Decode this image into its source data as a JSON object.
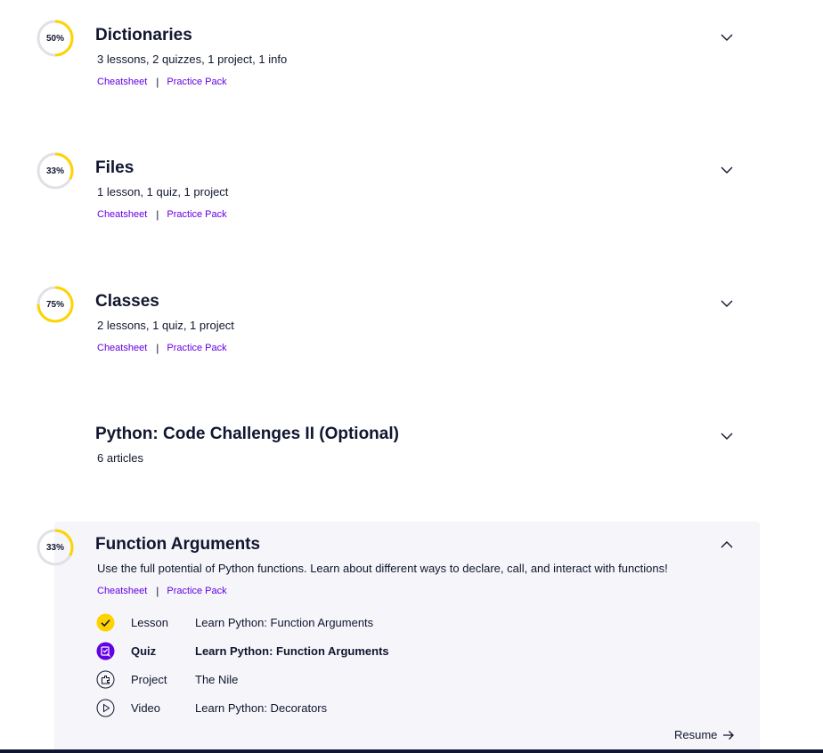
{
  "colors": {
    "ring_progress": "#ffd300",
    "ring_track": "#e0e0e6",
    "link": "#6400e4",
    "text": "#10162f",
    "panel_bg": "#f5f5fa",
    "quiz_icon_bg": "#6400e4"
  },
  "modules": [
    {
      "title": "Dictionaries",
      "progress_label": "50%",
      "progress": 0.5,
      "meta": "3 lessons, 2 quizzes, 1 project, 1 info",
      "links": {
        "cheatsheet": "Cheatsheet",
        "separator": "|",
        "practice": "Practice Pack"
      },
      "chevron": "chevron-down-icon"
    },
    {
      "title": "Files",
      "progress_label": "33%",
      "progress": 0.33,
      "meta": "1 lesson, 1 quiz, 1 project",
      "links": {
        "cheatsheet": "Cheatsheet",
        "separator": "|",
        "practice": "Practice Pack"
      },
      "chevron": "chevron-down-icon"
    },
    {
      "title": "Classes",
      "progress_label": "75%",
      "progress": 0.75,
      "meta": "2 lessons, 1 quiz, 1 project",
      "links": {
        "cheatsheet": "Cheatsheet",
        "separator": "|",
        "practice": "Practice Pack"
      },
      "chevron": "chevron-down-icon"
    },
    {
      "title": "Python: Code Challenges II (Optional)",
      "meta": "6 articles",
      "chevron": "chevron-down-icon"
    },
    {
      "title": "Function Arguments",
      "progress_label": "33%",
      "progress": 0.33,
      "meta": "Use the full potential of Python functions. Learn about different ways to declare, call, and interact with functions!",
      "links": {
        "cheatsheet": "Cheatsheet",
        "separator": "|",
        "practice": "Practice Pack"
      },
      "chevron": "chevron-up-icon",
      "items": [
        {
          "icon": "checkmark-icon",
          "kind": "Lesson",
          "name": "Learn Python: Function Arguments"
        },
        {
          "icon": "quiz-icon",
          "kind": "Quiz",
          "name": "Learn Python: Function Arguments"
        },
        {
          "icon": "project-icon",
          "kind": "Project",
          "name": "The Nile"
        },
        {
          "icon": "play-icon",
          "kind": "Video",
          "name": "Learn Python: Decorators"
        }
      ],
      "resume_label": "Resume"
    }
  ]
}
